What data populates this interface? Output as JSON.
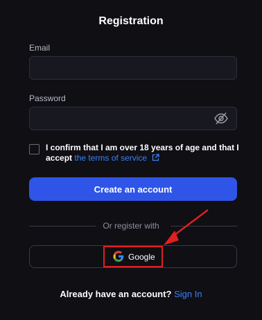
{
  "page": {
    "title": "Registration"
  },
  "form": {
    "email_label": "Email",
    "email_value": "",
    "email_placeholder": "",
    "password_label": "Password",
    "password_value": "",
    "password_placeholder": ""
  },
  "consent": {
    "text": "I confirm that I am over 18 years of age and that I accept",
    "link_text": "the terms of service",
    "checked": false
  },
  "actions": {
    "create_label": "Create an account",
    "divider_text": "Or register with",
    "google_label": "Google"
  },
  "footer": {
    "prompt": "Already have an account?",
    "signin_label": "Sign In"
  },
  "icons": {
    "password_toggle": "eye-off-icon",
    "terms_link": "external-link-icon",
    "provider": "google-logo-icon",
    "annotation": "arrow-icon"
  },
  "colors": {
    "background": "#0f0f14",
    "accent": "#2f55e8",
    "link": "#3b82f6",
    "highlight": "#e02020"
  }
}
